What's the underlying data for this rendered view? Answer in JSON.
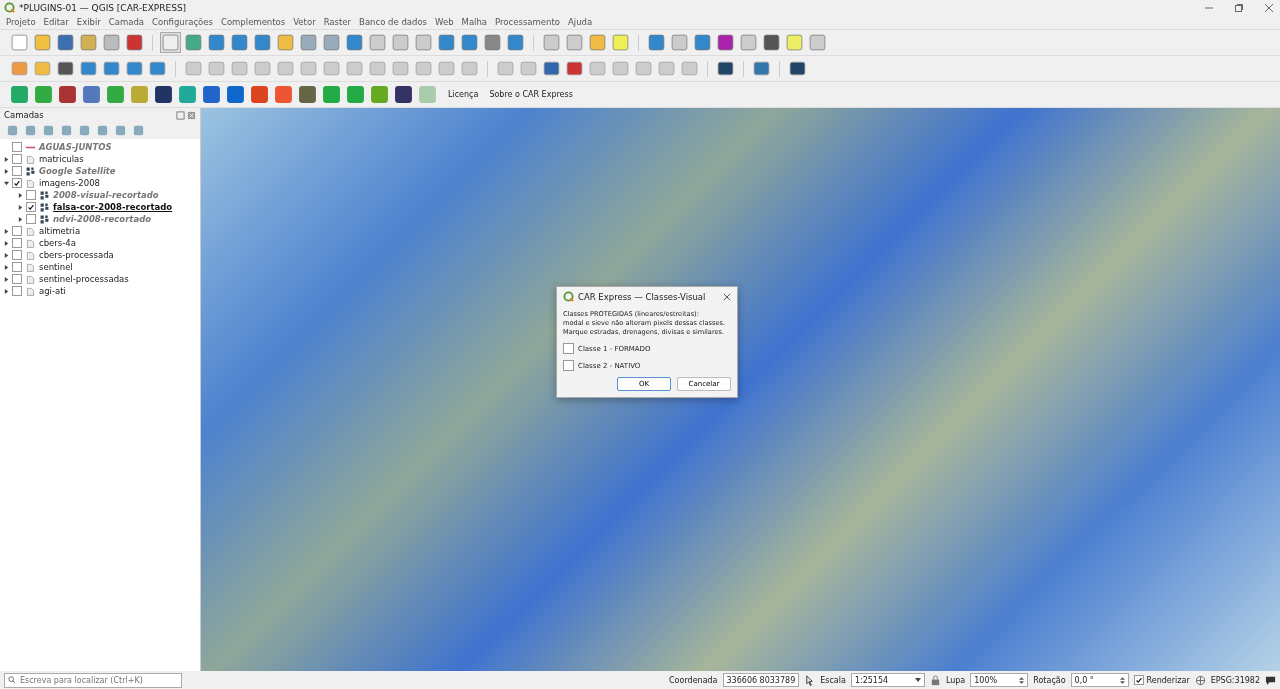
{
  "window": {
    "title": "*PLUGINS-01 — QGIS [CAR-EXPRESS]"
  },
  "menu": [
    "Projeto",
    "Editar",
    "Exibir",
    "Camada",
    "Configurações",
    "Complementos",
    "Vetor",
    "Raster",
    "Banco de dados",
    "Web",
    "Malha",
    "Processamento",
    "Ajuda"
  ],
  "plugin_toolbar": {
    "links": [
      "Licença",
      "Sobre o CAR Express"
    ]
  },
  "layers_panel": {
    "title": "Camadas",
    "layers": [
      {
        "name": "AGUAS-JUNTOS",
        "kind": "line",
        "checked": false,
        "dimmed": true,
        "selected": false
      },
      {
        "name": "matriculas",
        "kind": "group",
        "checked": false,
        "dimmed": false,
        "selected": false,
        "expanded": false
      },
      {
        "name": "Google Satellite",
        "kind": "raster",
        "checked": false,
        "dimmed": true,
        "selected": false,
        "expanded": false
      },
      {
        "name": "imagens-2008",
        "kind": "group",
        "checked": true,
        "dimmed": false,
        "selected": false,
        "expanded": true,
        "children": [
          {
            "name": "2008-visual-recortado",
            "kind": "raster",
            "checked": false,
            "dimmed": true,
            "selected": false,
            "expanded": false
          },
          {
            "name": "falsa-cor-2008-recortado",
            "kind": "raster",
            "checked": true,
            "dimmed": false,
            "selected": true,
            "expanded": false
          },
          {
            "name": "ndvi-2008-recortado",
            "kind": "raster",
            "checked": false,
            "dimmed": true,
            "selected": false,
            "expanded": false
          }
        ]
      },
      {
        "name": "altimetria",
        "kind": "group",
        "checked": false,
        "dimmed": false,
        "selected": false,
        "expanded": false
      },
      {
        "name": "cbers-4a",
        "kind": "group",
        "checked": false,
        "dimmed": false,
        "selected": false,
        "expanded": false
      },
      {
        "name": "cbers-processada",
        "kind": "group",
        "checked": false,
        "dimmed": false,
        "selected": false,
        "expanded": false
      },
      {
        "name": "sentinel",
        "kind": "group",
        "checked": false,
        "dimmed": false,
        "selected": false,
        "expanded": false
      },
      {
        "name": "sentinel-processadas",
        "kind": "group",
        "checked": false,
        "dimmed": false,
        "selected": false,
        "expanded": false
      },
      {
        "name": "agi-ati",
        "kind": "group",
        "checked": false,
        "dimmed": false,
        "selected": false,
        "expanded": false
      }
    ]
  },
  "dialog": {
    "title": "CAR Express — Classes-Visual",
    "message": "Classes PROTEGIDAS (lineares/estreitas):\nmodal e sieve não alteram pixels dessas classes.\nMarque estradas, drenagens, divisas e similares.",
    "options": [
      {
        "label": "Classe 1 - FORMADO",
        "checked": false
      },
      {
        "label": "Classe 2 - NATIVO",
        "checked": false
      }
    ],
    "buttons": [
      "OK",
      "Cancelar"
    ]
  },
  "status_bar": {
    "search": {
      "placeholder": "Escreva para localizar (Ctrl+K)"
    },
    "coordinate_label": "Coordenada",
    "coordinate": "336606  8033789",
    "scale_label": "Escala",
    "scale": "1:25154",
    "magnifier_label": "Lupa",
    "magnifier": "100%",
    "rotation_label": "Rotação",
    "rotation": "0,0 °",
    "render": {
      "label": "Renderizar",
      "checked": true
    },
    "crs": "EPSG:31982"
  }
}
